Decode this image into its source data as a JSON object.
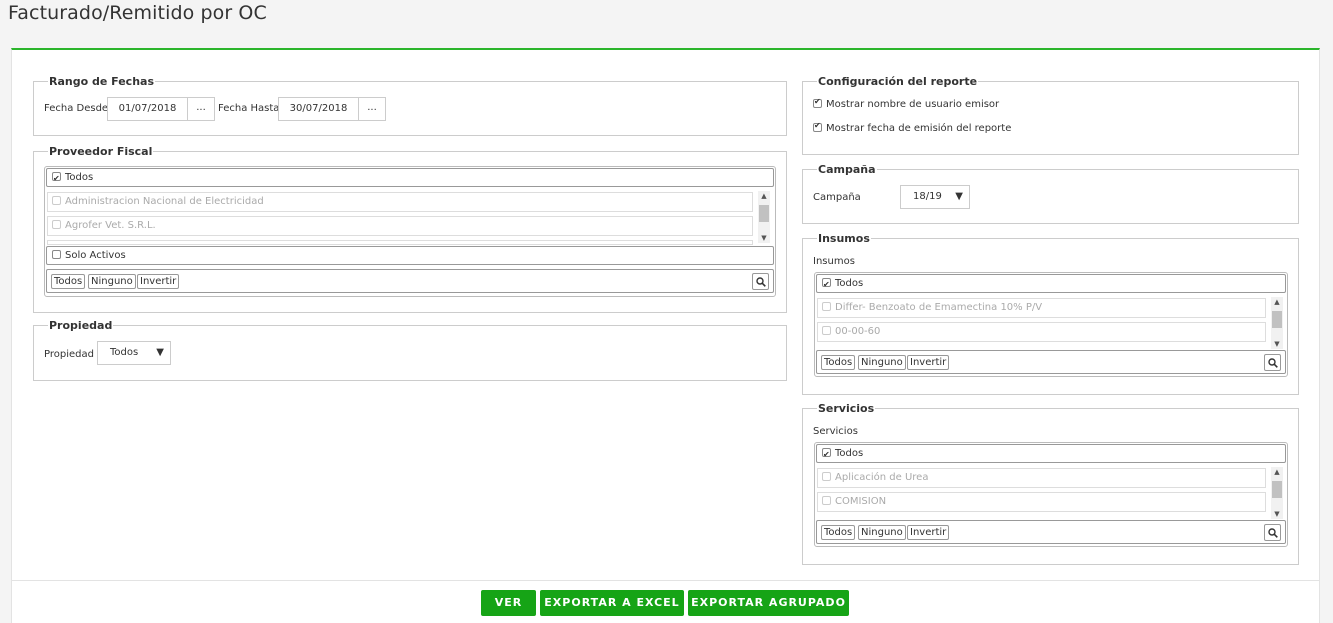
{
  "page": {
    "title": "Facturado/Remitido por OC"
  },
  "rango": {
    "legend": "Rango de Fechas",
    "desde_label": "Fecha Desde",
    "desde_value": "01/07/2018",
    "hasta_label": "Fecha Hasta",
    "hasta_value": "30/07/2018",
    "picker_label": "..."
  },
  "proveedor": {
    "legend": "Proveedor Fiscal",
    "todos": "Todos",
    "items": [
      "Administracion Nacional de Electricidad",
      "Agrofer Vet. S.R.L."
    ],
    "solo_activos": "Solo Activos",
    "btn_todos": "Todos",
    "btn_ninguno": "Ninguno",
    "btn_invertir": "Invertir"
  },
  "propiedad": {
    "legend": "Propiedad",
    "label": "Propiedad",
    "value": "Todos"
  },
  "config": {
    "legend": "Configuración del reporte",
    "opt1": "Mostrar nombre de usuario emisor",
    "opt2": "Mostrar fecha de emisión del reporte"
  },
  "campana": {
    "legend": "Campaña",
    "label": "Campaña",
    "value": "18/19"
  },
  "insumos": {
    "legend": "Insumos",
    "label": "Insumos",
    "todos": "Todos",
    "items": [
      "Differ- Benzoato de Emamectina 10% P/V",
      "00-00-60"
    ],
    "btn_todos": "Todos",
    "btn_ninguno": "Ninguno",
    "btn_invertir": "Invertir"
  },
  "servicios": {
    "legend": "Servicios",
    "label": "Servicios",
    "todos": "Todos",
    "items": [
      "Aplicación de Urea",
      "COMISION"
    ],
    "btn_todos": "Todos",
    "btn_ninguno": "Ninguno",
    "btn_invertir": "Invertir"
  },
  "actions": {
    "ver": "VER",
    "excel": "EXPORTAR A EXCEL",
    "agrupado": "EXPORTAR AGRUPADO"
  },
  "colors": {
    "accent": "#2bb52b",
    "button": "#16a416"
  }
}
